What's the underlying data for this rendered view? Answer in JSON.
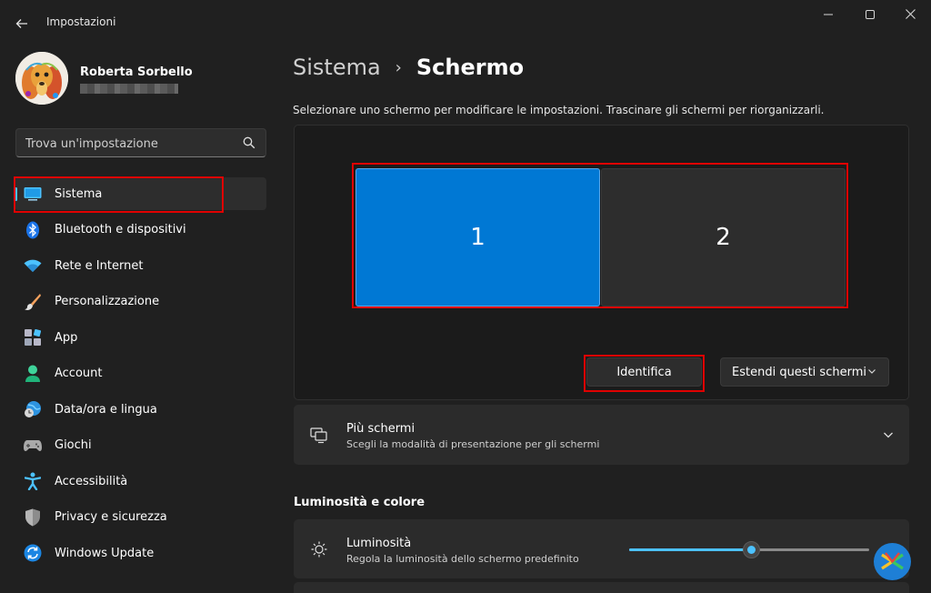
{
  "window": {
    "title": "Impostazioni"
  },
  "profile": {
    "name": "Roberta Sorbello"
  },
  "search": {
    "placeholder": "Trova un'impostazione"
  },
  "sidebar": {
    "items": [
      {
        "label": "Sistema",
        "icon": "system-icon",
        "active": true
      },
      {
        "label": "Bluetooth e dispositivi",
        "icon": "bluetooth-icon"
      },
      {
        "label": "Rete e Internet",
        "icon": "wifi-icon"
      },
      {
        "label": "Personalizzazione",
        "icon": "brush-icon"
      },
      {
        "label": "App",
        "icon": "apps-icon"
      },
      {
        "label": "Account",
        "icon": "account-icon"
      },
      {
        "label": "Data/ora e lingua",
        "icon": "globe-clock-icon"
      },
      {
        "label": "Giochi",
        "icon": "gamepad-icon"
      },
      {
        "label": "Accessibilità",
        "icon": "accessibility-icon"
      },
      {
        "label": "Privacy e sicurezza",
        "icon": "shield-icon"
      },
      {
        "label": "Windows Update",
        "icon": "update-icon"
      }
    ]
  },
  "header": {
    "parent": "Sistema",
    "separator": "›",
    "current": "Schermo"
  },
  "display": {
    "instruction": "Selezionare uno schermo per modificare le impostazioni. Trascinare gli schermi per riorganizzarli.",
    "monitors": [
      "1",
      "2"
    ],
    "selected_monitor": "1",
    "identify_label": "Identifica",
    "mode_value": "Estendi questi schermi"
  },
  "multi_display": {
    "title": "Più schermi",
    "subtitle": "Scegli la modalità di presentazione per gli schermi"
  },
  "brightness_section": {
    "title": "Luminosità e colore",
    "brightness_title": "Luminosità",
    "brightness_subtitle": "Regola la luminosità dello schermo predefinito",
    "brightness_level_percent": 51
  },
  "colors": {
    "accent": "#0078d4",
    "slider": "#4cc2ff",
    "highlight": "#e00000",
    "background": "#202020"
  }
}
